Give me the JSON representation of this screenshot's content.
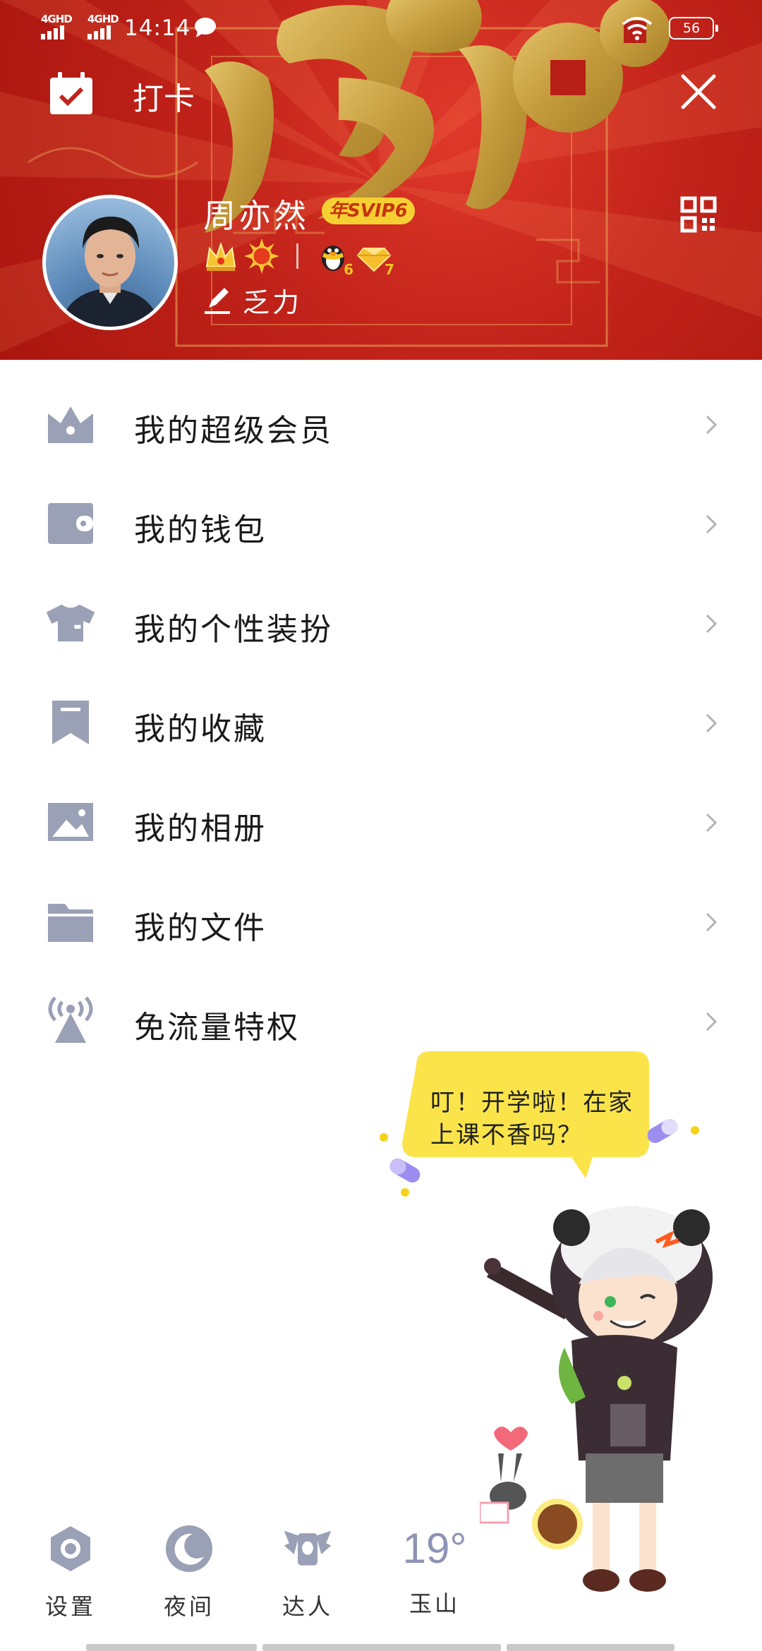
{
  "status_bar": {
    "network_1": "4GHD",
    "network_2": "4GHD",
    "time": "14:14",
    "battery": "56"
  },
  "header": {
    "checkin_label": "打卡",
    "username": "周亦然",
    "vip_badge": "年SVIP6",
    "badge_counts": [
      "6",
      "7"
    ],
    "signature": "乏力"
  },
  "menu": {
    "items": [
      {
        "label": "我的超级会员",
        "icon": "crown-icon"
      },
      {
        "label": "我的钱包",
        "icon": "wallet-icon"
      },
      {
        "label": "我的个性装扮",
        "icon": "tshirt-icon"
      },
      {
        "label": "我的收藏",
        "icon": "bookmark-icon"
      },
      {
        "label": "我的相册",
        "icon": "photo-album-icon"
      },
      {
        "label": "我的文件",
        "icon": "folder-icon"
      },
      {
        "label": "免流量特权",
        "icon": "broadcast-icon"
      }
    ]
  },
  "mascot": {
    "bubble_text": "叮！开学啦！在家上课不香吗？"
  },
  "bottom_bar": {
    "settings_label": "设置",
    "night_label": "夜间",
    "expert_label": "达人",
    "weather_temp": "19°",
    "weather_city": "玉山"
  },
  "colors": {
    "header_red": "#c2231a",
    "icon_gray": "#9aa0b5",
    "gold": "#c9a441",
    "bubble_yellow": "#fbe44a"
  }
}
